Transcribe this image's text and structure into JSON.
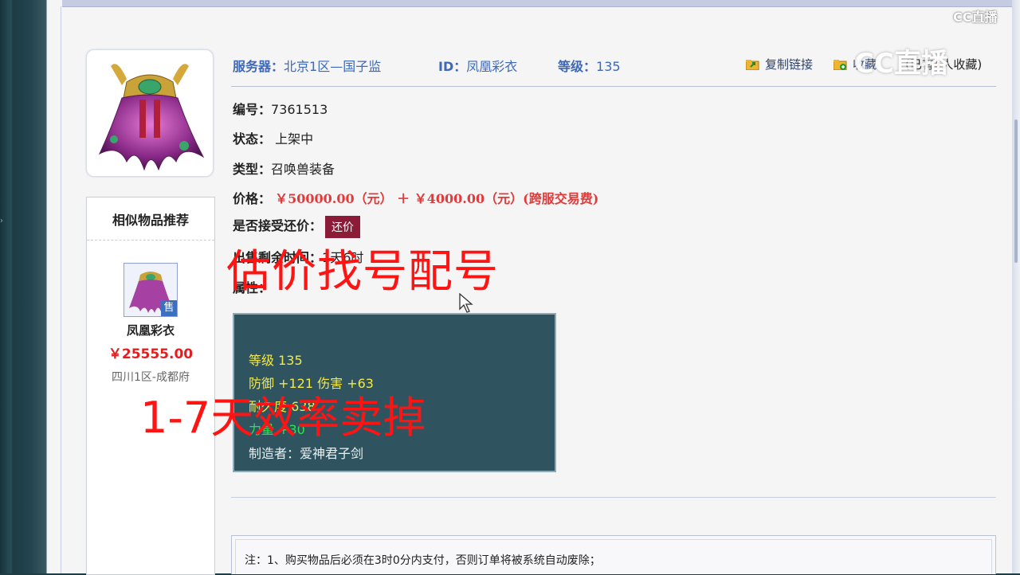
{
  "header": {
    "server_label": "服务器：",
    "server_value": "北京1区—国子监",
    "id_label": "ID：",
    "id_value": "凤凰彩衣",
    "level_label": "等级：",
    "level_value": "135",
    "copy_link": "复制链接",
    "fav_link": "收藏",
    "fav_count": "(已有",
    "fav_count_num": "4",
    "fav_count_tail": "人收藏)"
  },
  "details": {
    "serial_label": "编号：",
    "serial_value": "7361513",
    "status_label": "状态：",
    "status_value": "上架中",
    "type_label": "类型：",
    "type_value": "召唤兽装备",
    "price_label": "价格：",
    "price_value": "￥50000.00（元） ＋ ￥4000.00（元）(跨服交易费)",
    "counter_label": "是否接受还价：",
    "counter_button": "还价",
    "remaining_label": "出售剩余时间：",
    "remaining_value": "1天6时",
    "attr_label": "属性："
  },
  "attributes": {
    "level": "等级 135",
    "defense": "防御 +121 伤害 +63",
    "durability": "耐久度 638",
    "strength": "力量 +30",
    "maker": "制造者：爱神君子剑"
  },
  "similar": {
    "title": "相似物品推荐",
    "sale_badge": "售",
    "name": "凤凰彩衣",
    "price": "￥25555.00",
    "server": "四川1区-成都府"
  },
  "notice": {
    "text": "注：1、购买物品后必须在3时0分内支付，否则订单将被系统自动废除；"
  },
  "overlay": {
    "line1": "估价找号配号",
    "line2": "1-7天效率卖掉"
  },
  "watermark": {
    "small": "CC直播",
    "large": "CC直播"
  }
}
